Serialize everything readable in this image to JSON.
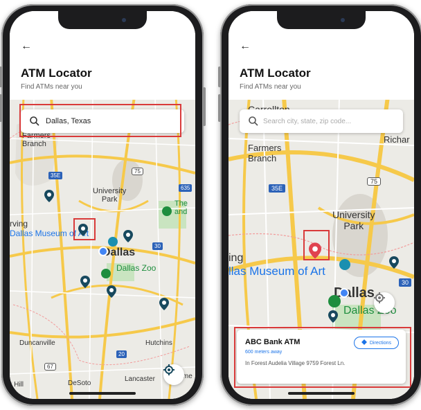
{
  "app": {
    "back_icon": "arrow-left-icon",
    "title": "ATM Locator",
    "subtitle": "Find ATMs near you"
  },
  "left_screen": {
    "search": {
      "value": "Dallas, Texas"
    },
    "map_labels": {
      "farmers_branch": "Farmers\nBranch",
      "university_park": "University\nPark",
      "irving": "rving",
      "dallas_museum": "Dallas Museum of Art",
      "dallas": "Dallas",
      "dallas_zoo": "Dallas Zoo",
      "the_and": "The\nand",
      "duncanville": "Duncanville",
      "hutchins": "Hutchins",
      "desoto": "DeSoto",
      "lancaster": "Lancaster",
      "wilme": "Wilme",
      "hill": "r Hill",
      "hw_35e": "35E",
      "hw_75": "75",
      "hw_635": "635",
      "hw_30": "30",
      "hw_67": "67",
      "hw_20": "20"
    }
  },
  "right_screen": {
    "search": {
      "placeholder": "Search city, state, zip code..."
    },
    "map_labels": {
      "carrollton": "Carrollton",
      "farmers_branch": "Farmers\nBranch",
      "richar": "Richar",
      "university_park": "University\nPark",
      "ing": "ing",
      "dallas_museum": "llas Museum of Art",
      "dallas": "Dallas",
      "dallas_zoo": "Dallas Zoo",
      "hw_35e": "35E",
      "hw_75": "75",
      "hw_30": "30"
    },
    "atm_card": {
      "name": "ABC Bank ATM",
      "distance": "600 meters away",
      "address": "In Forest Audelia Village 9759 Forest Ln.",
      "directions_label": "Directions"
    }
  },
  "colors": {
    "highlight": "#d93a3a",
    "accent": "#1a73e8",
    "pin_dark": "#17495e",
    "pin_red": "#e0424f",
    "park": "#c9e4c0",
    "road": "#f6c94a"
  }
}
